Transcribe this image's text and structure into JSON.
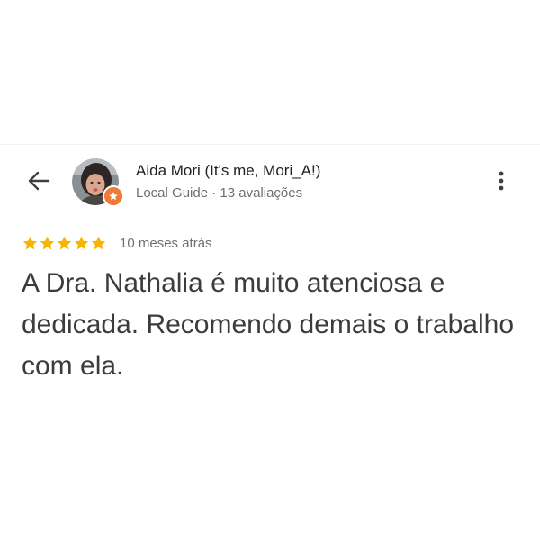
{
  "review": {
    "reviewer": {
      "name": "Aida Mori (It's me, Mori_A!)",
      "meta": "Local Guide · 13 avaliações",
      "avatar_icon": "user-photo",
      "badge_icon": "local-guide-star-icon",
      "badge_color": "#ee7a35"
    },
    "rating": {
      "stars": 5,
      "max_stars": 5,
      "star_color": "#f6b500"
    },
    "date": "10 meses atrás",
    "text": "A Dra. Nathalia é muito atenciosa e dedicada. Recomendo demais o trabalho com ela."
  },
  "icons": {
    "back": "arrow-left-icon",
    "more": "more-vert-icon"
  }
}
